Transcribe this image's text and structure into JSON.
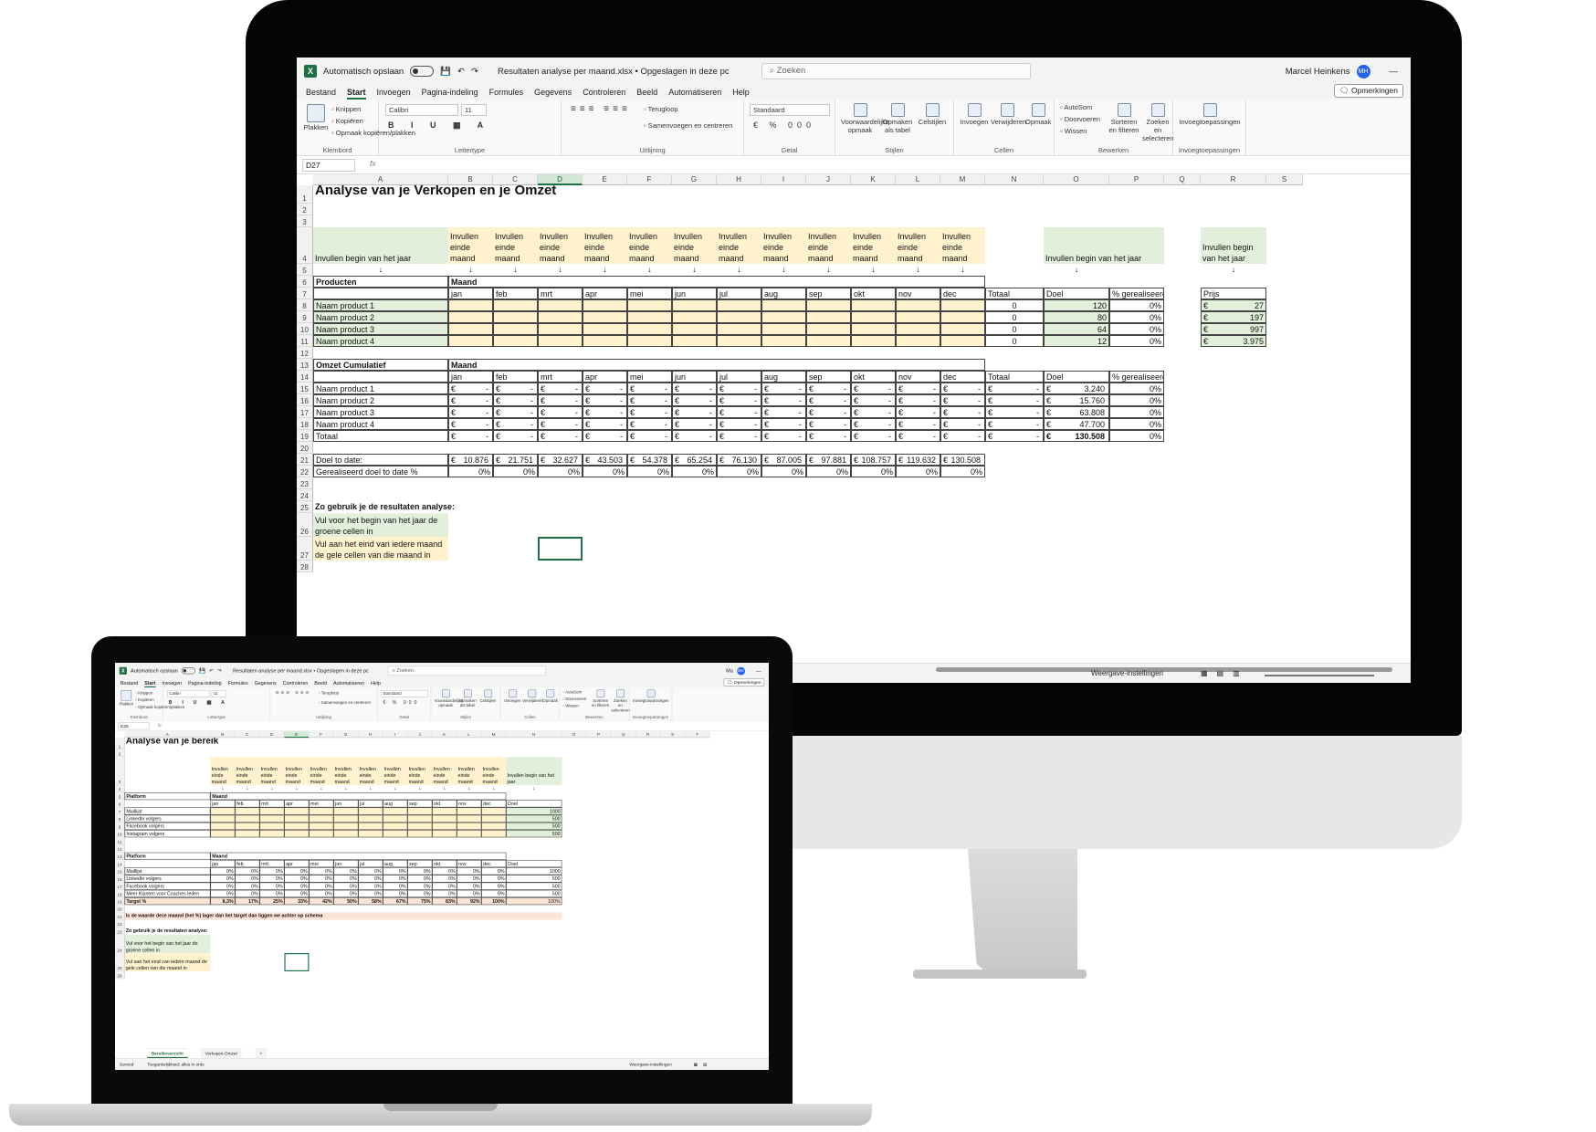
{
  "ui": {
    "autosave": "Automatisch opslaan",
    "search": "Zoeken",
    "comments": "Opmerkingen",
    "user": "Marcel Heinkens",
    "user_initials": "MH",
    "fx": "fx",
    "view_settings": "Weergave-instellingen",
    "status_ready": "Gereed",
    "status_access": "Toegankelijkheid: alles in orde",
    "menu": [
      "Bestand",
      "Start",
      "Invoegen",
      "Pagina-indeling",
      "Formules",
      "Gegevens",
      "Controleren",
      "Beeld",
      "Automatiseren",
      "Help"
    ],
    "ribbon": {
      "plakken": "Plakken",
      "knippen": "Knippen",
      "kopieren": "Kopiëren",
      "opmaak": "Opmaak kopiëren/plakken",
      "klembord": "Klembord",
      "font": "Calibri",
      "size": "11",
      "lettertype": "Lettertype",
      "terugloop": "Terugloop",
      "samenvoegen": "Samenvoegen en centreren",
      "uitlijning": "Uitlijning",
      "numfmt": "Standaard",
      "getal": "Getal",
      "voorw": "Voorwaardelijke opmaak",
      "alstabel": "Opmaken als tabel",
      "celstijlen": "Celstijlen",
      "stijlen": "Stijlen",
      "invoegen": "Invoegen",
      "verwijderen": "Verwijderen",
      "opmaakc": "Opmaak",
      "cellen": "Cellen",
      "autosom": "AutoSom",
      "doorvoeren": "Doorvoeren",
      "wissen": "Wissen",
      "sorteren": "Sorteren en filteren",
      "zoeken": "Zoeken en selecteren",
      "bewerken": "Bewerken",
      "invoegtoep": "Invoegtoepassingen"
    }
  },
  "desktop": {
    "filename": "Resultaten analyse per maand.xlsx • Opgeslagen in deze pc",
    "namebox": "D27",
    "cols": [
      "A",
      "B",
      "C",
      "D",
      "E",
      "F",
      "G",
      "H",
      "I",
      "J",
      "K",
      "L",
      "M",
      "N",
      "O",
      "P",
      "Q",
      "R",
      "S"
    ],
    "title": "Analyse van je Verkopen en je Omzet",
    "fill_end": "Invullen einde maand",
    "fill_begin": "Invullen begin van het jaar",
    "arrow": "↓",
    "producten": "Producten",
    "maand": "Maand",
    "months": [
      "jan",
      "feb",
      "mrt",
      "apr",
      "mei",
      "jun",
      "jul",
      "aug",
      "sep",
      "okt",
      "nov",
      "dec"
    ],
    "totaal": "Totaal",
    "doel": "Doel",
    "pct": "% gerealiseerd",
    "prijs": "Prijs",
    "euro": "€",
    "dash": "-",
    "products": [
      {
        "name": "Naam product 1",
        "total": "0",
        "goal": "120",
        "pct": "0%",
        "price": "27",
        "omzet_goal": "3.240",
        "omzet_pct": "0%"
      },
      {
        "name": "Naam product 2",
        "total": "0",
        "goal": "80",
        "pct": "0%",
        "price": "197",
        "omzet_goal": "15.760",
        "omzet_pct": "0%"
      },
      {
        "name": "Naam product 3",
        "total": "0",
        "goal": "64",
        "pct": "0%",
        "price": "997",
        "omzet_goal": "63.808",
        "omzet_pct": "0%"
      },
      {
        "name": "Naam product 4",
        "total": "0",
        "goal": "12",
        "pct": "0%",
        "price": "3.975",
        "omzet_goal": "47.700",
        "omzet_pct": "0%"
      }
    ],
    "omzet": "Omzet Cumulatief",
    "totaal_row": "Totaal",
    "totaal_goal": "130.508",
    "totaal_pct": "0%",
    "doel_to_date": "Doel to date:",
    "doel_values": [
      "10.876",
      "21.751",
      "32.627",
      "43.503",
      "54.378",
      "65.254",
      "76.130",
      "87.005",
      "97.881",
      "108.757",
      "119.632",
      "130.508"
    ],
    "gerealiseerd": "Gerealiseerd doel to date %",
    "gerealiseerd_values": [
      "0%",
      "0%",
      "0%",
      "0%",
      "0%",
      "0%",
      "0%",
      "0%",
      "0%",
      "0%",
      "0%",
      "0%"
    ],
    "howto": "Zo gebruik je de resultaten analyse:",
    "howto_green": "Vul voor het begin van het jaar de groene cellen in",
    "howto_yellow": "Vul aan het eind van iedere maand de gele cellen van die maand in"
  },
  "laptop": {
    "filename": "Resultaten analyse per maand.xlsx • Opgeslagen in deze pc",
    "namebox": "E25",
    "user_initial": "Ma",
    "cols": [
      "A",
      "B",
      "C",
      "D",
      "E",
      "F",
      "G",
      "H",
      "I",
      "J",
      "K",
      "L",
      "M",
      "N",
      "O",
      "P",
      "Q",
      "R",
      "S",
      "T"
    ],
    "title": "Analyse van je bereik",
    "fill_end": "Invullen einde maand",
    "fill_begin": "Invullen begin van het jaar",
    "arrow": "↓",
    "platform": "Platform",
    "maand": "Maand",
    "doel": "Doel",
    "months": [
      "jan",
      "feb",
      "mrt",
      "apr",
      "mei",
      "jun",
      "jul",
      "aug",
      "sep",
      "okt",
      "nov",
      "dec"
    ],
    "rows1": [
      {
        "name": "Maillijst",
        "goal": "1000"
      },
      {
        "name": "LinkedIn volgers",
        "goal": "500"
      },
      {
        "name": "Facebook volgers",
        "goal": "500"
      },
      {
        "name": "Instagram volgers",
        "goal": "500"
      }
    ],
    "rows2": [
      {
        "name": "Maillijst",
        "goal": "1000"
      },
      {
        "name": "LinkedIn volgers",
        "goal": "500"
      },
      {
        "name": "Facebook volgers",
        "goal": "500"
      },
      {
        "name": "Meer Klanten voor Coaches leden",
        "goal": "500"
      }
    ],
    "zero": "0%",
    "target_label": "Target %",
    "target_values": [
      "8,3%",
      "17%",
      "25%",
      "33%",
      "42%",
      "50%",
      "58%",
      "67%",
      "75%",
      "83%",
      "92%",
      "100%"
    ],
    "target_total": "100%",
    "warning": "Is de waarde deze maand (het %) lager dan het target dan liggen we achter op schema",
    "howto": "Zo gebruik je de resultaten analyse:",
    "howto_green": "Vul voor het begin van het jaar de groene cellen in",
    "howto_yellow": "Vul aan het eind van iedere maand de gele cellen van die maand in",
    "tabs": [
      "Bereikoverzicht",
      "Verkopen-Omzet"
    ],
    "plus": "+"
  }
}
